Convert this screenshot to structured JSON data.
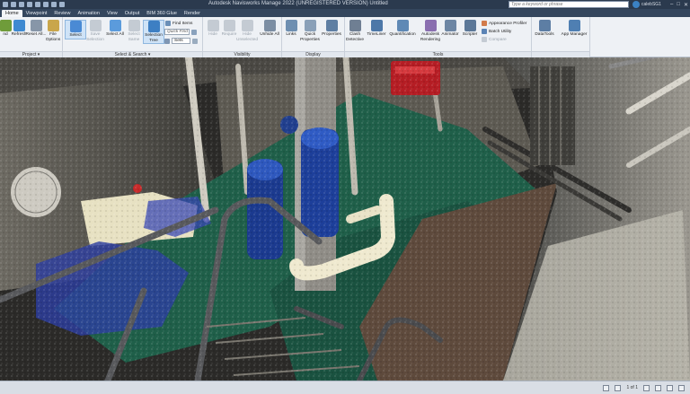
{
  "window": {
    "title": "Autodesk Navisworks Manage 2022 (UNREGISTERED VERSION)    Untitled",
    "search_placeholder": "Type a keyword or phrase",
    "user": "calebSG1"
  },
  "tabs": [
    "Home",
    "Viewpoint",
    "Review",
    "Animation",
    "View",
    "Output",
    "BIM 360 Glue",
    "Render"
  ],
  "ribbon": {
    "project": {
      "label": "Project",
      "buttons": [
        "nd",
        "Refresh",
        "Reset All...",
        "File Options"
      ]
    },
    "select_search": {
      "label": "Select & Search",
      "buttons": [
        "Select",
        "Save Selection",
        "Select All",
        "Select Same",
        "Selection Tree"
      ],
      "find_items": "Find Items",
      "quick_find": "Quick Find",
      "sets": "Sets"
    },
    "visibility": {
      "label": "Visibility",
      "buttons": [
        "Hide",
        "Require",
        "Hide Unselected",
        "Unhide All"
      ]
    },
    "display": {
      "label": "Display",
      "buttons": [
        "Links",
        "Quick Properties",
        "Properties"
      ]
    },
    "tools": {
      "label": "Tools",
      "buttons": [
        "Clash Detective",
        "TimeLiner",
        "Quantification",
        "Autodesk Rendering",
        "Animator",
        "Scripter"
      ],
      "small": [
        "Appearance Profiler",
        "Batch Utility",
        "Compare"
      ]
    },
    "extra": {
      "buttons": [
        "DataTools",
        "App Manager"
      ]
    }
  },
  "statusbar": {
    "page": "1 of 1"
  },
  "colors": {
    "accent": "#3b82c4",
    "titlebar": "#2b3a4e",
    "ribbon": "#eef1f5",
    "floor_green": "#1f5f49"
  }
}
